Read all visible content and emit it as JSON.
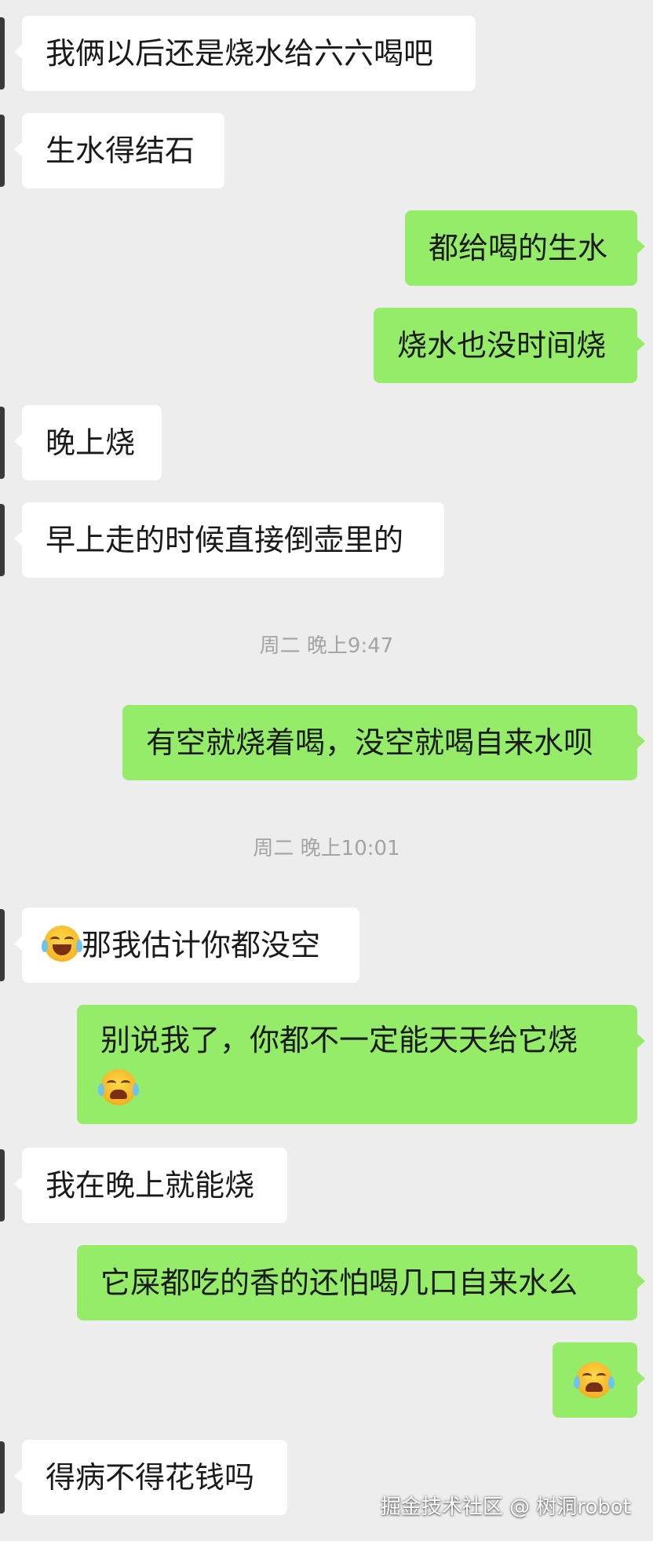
{
  "messages": [
    {
      "side": "in",
      "text": "我俩以后还是烧水给六六喝吧"
    },
    {
      "side": "in",
      "text": "生水得结石"
    },
    {
      "side": "out",
      "text": "都给喝的生水"
    },
    {
      "side": "out",
      "text": "烧水也没时间烧"
    },
    {
      "side": "in",
      "text": "晚上烧"
    },
    {
      "side": "in",
      "text": "早上走的时候直接倒壶里的"
    },
    {
      "side": "out",
      "text": "有空就烧着喝，没空就喝自来水呗"
    },
    {
      "side": "in",
      "emoji": "laugh-cry",
      "text": "那我估计你都没空"
    },
    {
      "side": "out",
      "line1": "别说我了，你都不一定能天天给它烧",
      "emoji": "loudly-crying"
    },
    {
      "side": "in",
      "text": "我在晚上就能烧"
    },
    {
      "side": "out",
      "text": "它屎都吃的香的还怕喝几口自来水么"
    },
    {
      "side": "out",
      "emoji": "loudly-crying",
      "text": ""
    },
    {
      "side": "in",
      "text": "得病不得花钱吗"
    }
  ],
  "timestamps": [
    "周二 晚上9:47",
    "周二 晚上10:01"
  ],
  "watermark": "掘金技术社区 @ 树洞robot",
  "colors": {
    "background": "#ededed",
    "incoming_bubble": "#ffffff",
    "outgoing_bubble": "#95ec69",
    "timestamp": "#a4a4a4"
  }
}
